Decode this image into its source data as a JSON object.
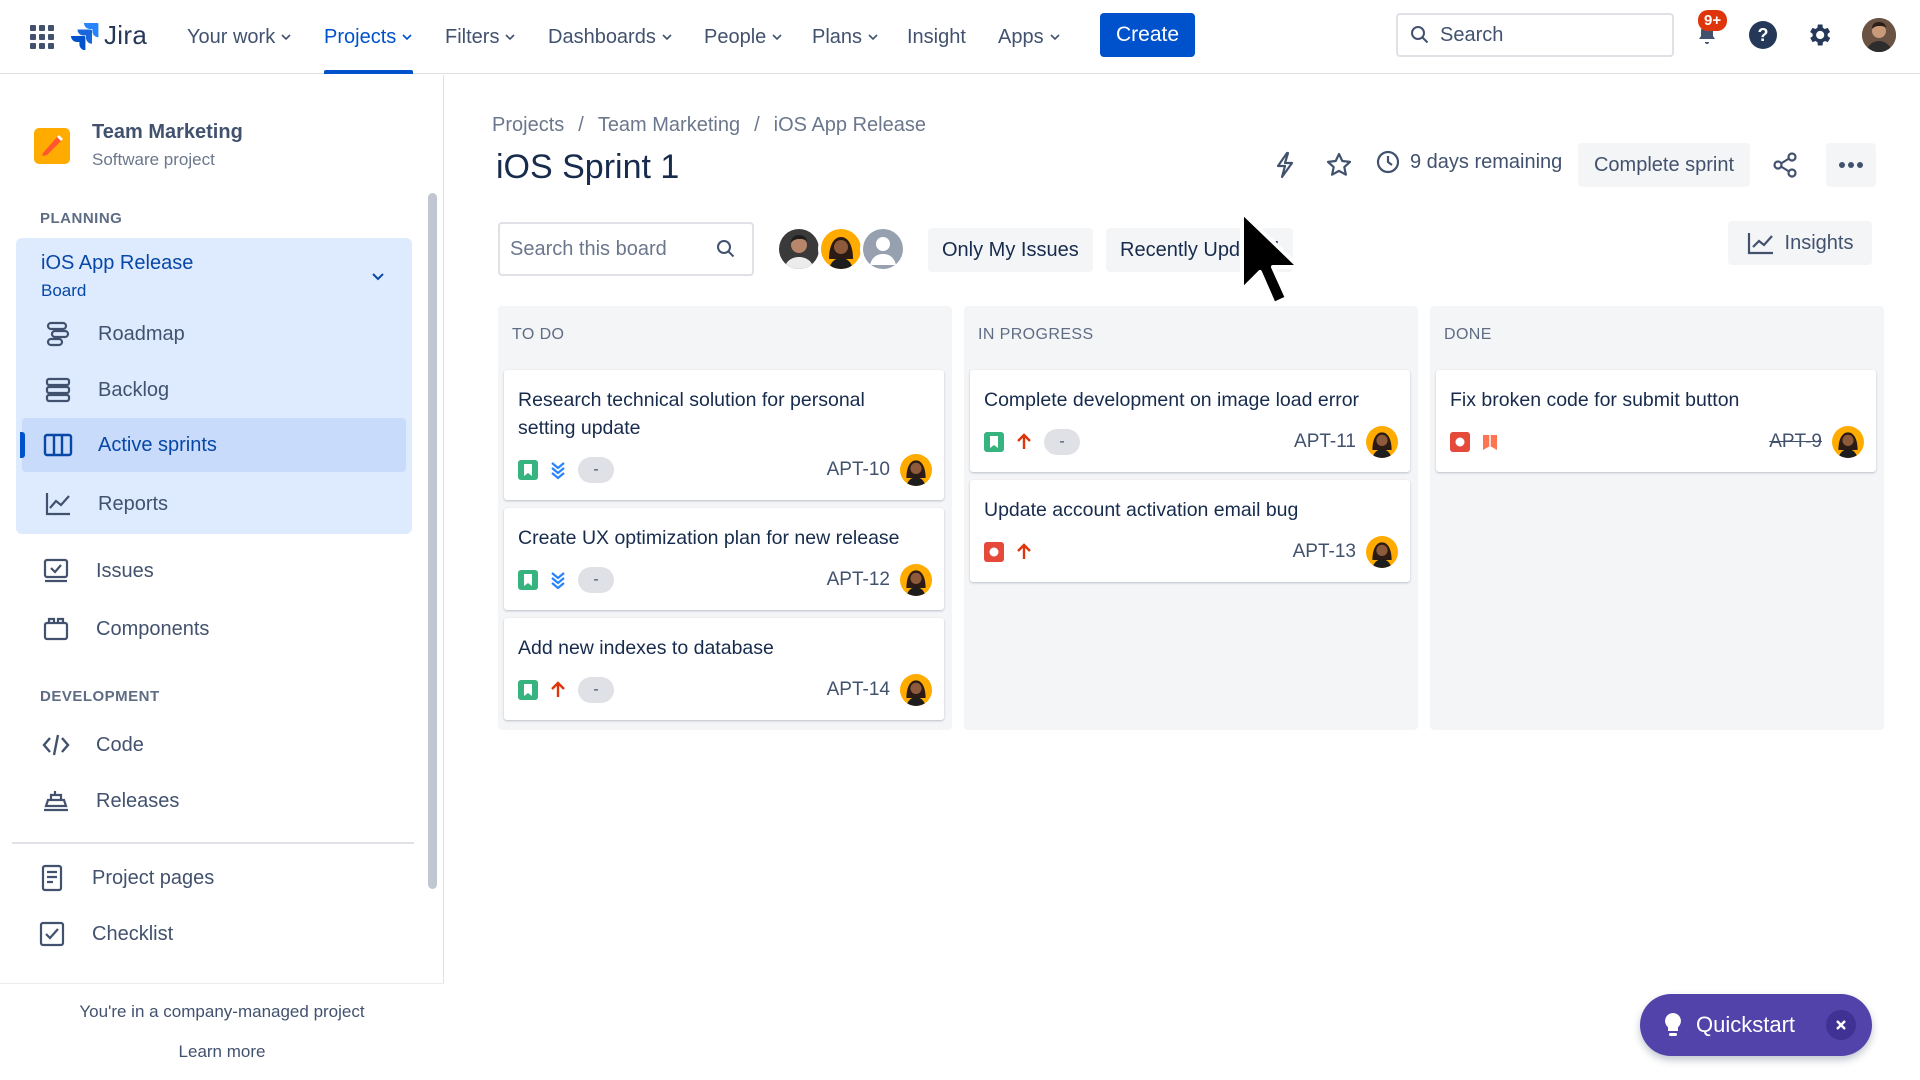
{
  "topnav": {
    "logo_text": "Jira",
    "items": [
      {
        "label": "Your work",
        "dropdown": true
      },
      {
        "label": "Projects",
        "dropdown": true,
        "active": true
      },
      {
        "label": "Filters",
        "dropdown": true
      },
      {
        "label": "Dashboards",
        "dropdown": true
      },
      {
        "label": "People",
        "dropdown": true
      },
      {
        "label": "Plans",
        "dropdown": true
      },
      {
        "label": "Insight",
        "dropdown": false
      },
      {
        "label": "Apps",
        "dropdown": true
      }
    ],
    "create_label": "Create",
    "search_placeholder": "Search",
    "notification_badge": "9+"
  },
  "sidebar": {
    "project_name": "Team Marketing",
    "project_type": "Software project",
    "planning_label": "PLANNING",
    "board_name": "iOS App Release",
    "board_sub": "Board",
    "planning_items": [
      {
        "label": "Roadmap",
        "icon": "roadmap-icon"
      },
      {
        "label": "Backlog",
        "icon": "backlog-icon"
      },
      {
        "label": "Active sprints",
        "icon": "active-sprints-icon",
        "active": true
      },
      {
        "label": "Reports",
        "icon": "reports-icon"
      }
    ],
    "other_items": [
      {
        "label": "Issues",
        "icon": "issues-icon"
      },
      {
        "label": "Components",
        "icon": "components-icon"
      }
    ],
    "development_label": "DEVELOPMENT",
    "development_items": [
      {
        "label": "Code",
        "icon": "code-icon"
      },
      {
        "label": "Releases",
        "icon": "releases-icon"
      }
    ],
    "extra_items": [
      {
        "label": "Project pages",
        "icon": "project-pages-icon"
      },
      {
        "label": "Checklist",
        "icon": "checklist-icon"
      }
    ],
    "footer_text": "You're in a company-managed project",
    "footer_link": "Learn more"
  },
  "main": {
    "breadcrumb": [
      "Projects",
      "Team Marketing",
      "iOS App Release"
    ],
    "title": "iOS Sprint 1",
    "days_remaining": "9 days remaining",
    "complete_sprint_label": "Complete sprint",
    "board_search_placeholder": "Search this board",
    "filter_only_my": "Only My Issues",
    "filter_recent": "Recently Updated",
    "insights_label": "Insights"
  },
  "board": {
    "columns": [
      {
        "title": "TO DO",
        "cards": [
          {
            "title": "Research technical solution for personal setting update",
            "key": "APT-10",
            "type": "story",
            "priority": "lowest",
            "estimate": "-"
          },
          {
            "title": "Create UX optimization plan for new release",
            "key": "APT-12",
            "type": "story",
            "priority": "lowest",
            "estimate": "-"
          },
          {
            "title": "Add new indexes to database",
            "key": "APT-14",
            "type": "story",
            "priority": "high",
            "estimate": "-"
          }
        ]
      },
      {
        "title": "IN PROGRESS",
        "cards": [
          {
            "title": "Complete development on image load error",
            "key": "APT-11",
            "type": "story",
            "priority": "high",
            "estimate": "-"
          },
          {
            "title": "Update account activation email bug",
            "key": "APT-13",
            "type": "bug",
            "priority": "high"
          }
        ]
      },
      {
        "title": "DONE",
        "cards": [
          {
            "title": "Fix broken code for submit button",
            "key": "APT-9",
            "type": "bug",
            "flag": true,
            "done": true
          }
        ]
      }
    ]
  },
  "quickstart": {
    "label": "Quickstart"
  },
  "colors": {
    "brand": "#0052CC",
    "story": "#36B37E",
    "bug": "#E5493A",
    "high": "#DE350B",
    "lowest": "#2684FF",
    "quickstart": "#5243AA"
  }
}
